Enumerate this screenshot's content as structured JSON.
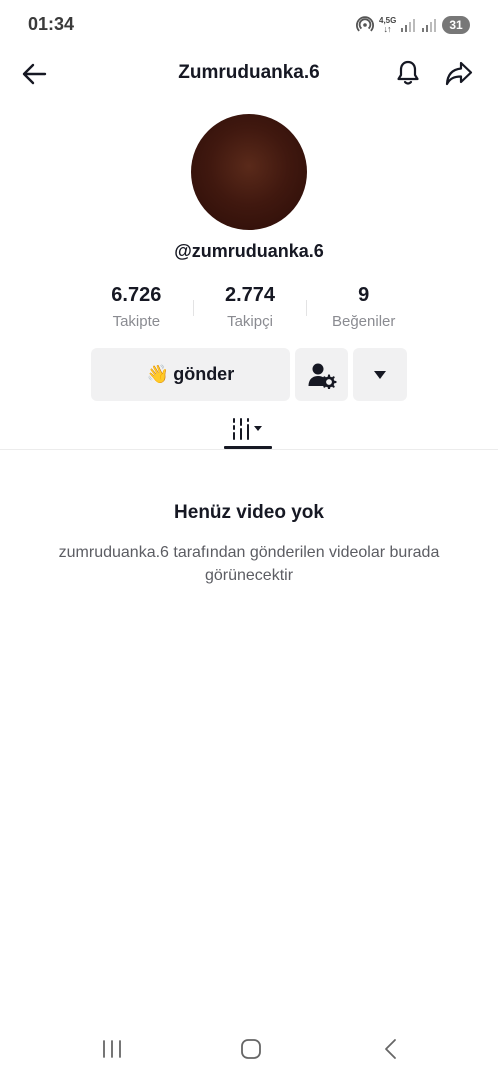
{
  "status_bar": {
    "time": "01:34",
    "network_type": "4,5G",
    "network_arrows": "↓↑",
    "battery": "31",
    "icons": [
      "hotspot-icon",
      "signal-icon",
      "signal-icon"
    ]
  },
  "header": {
    "title": "Zumruduanka.6",
    "icons": [
      "back-arrow-icon",
      "bell-icon",
      "share-icon"
    ]
  },
  "profile": {
    "username": "@zumruduanka.6",
    "avatar_color": "#40180f"
  },
  "stats": [
    {
      "value": "6.726",
      "label": "Takipte"
    },
    {
      "value": "2.774",
      "label": "Takipçi"
    },
    {
      "value": "9",
      "label": "Beğeniler"
    }
  ],
  "actions": {
    "send_emoji": "👋",
    "send_label": "gönder",
    "icons": [
      "user-settings-icon",
      "caret-down-icon"
    ]
  },
  "tabs": {
    "icons": [
      "videos-filter-icon"
    ]
  },
  "empty_state": {
    "title": "Henüz video yok",
    "description": "zumruduanka.6 tarafından gönderilen videolar burada görünecektir"
  },
  "nav_bar": {
    "icons": [
      "recents-icon",
      "home-icon",
      "nav-back-icon"
    ]
  },
  "colors": {
    "text_primary": "#161823",
    "text_secondary": "#8a8b91",
    "button_bg": "#f1f1f2"
  }
}
